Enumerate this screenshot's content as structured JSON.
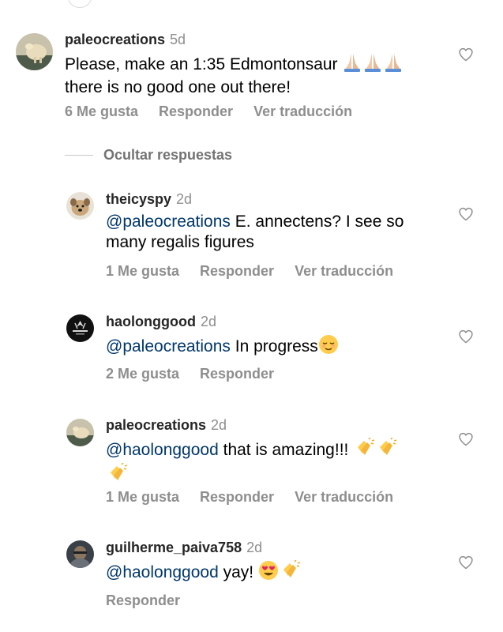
{
  "comments": [
    {
      "username": "paleocreations",
      "time": "5d",
      "mention": "",
      "text": "Please, make an 1:35 Edmontonsaur",
      "text_line2": "there is no good one out there!",
      "likes": "6 Me gusta",
      "reply": "Responder",
      "translate": "Ver traducción"
    },
    {
      "username": "theicyspy",
      "time": "2d",
      "mention": "@paleocreations",
      "text": " E. annectens? I see so",
      "text_line2": "many regalis figures",
      "likes": "1 Me gusta",
      "reply": "Responder",
      "translate": "Ver traducción"
    },
    {
      "username": "haolonggood",
      "time": "2d",
      "mention": "@paleocreations",
      "text": " In progress",
      "likes": "2 Me gusta",
      "reply": "Responder"
    },
    {
      "username": "paleocreations",
      "time": "2d",
      "mention": "@haolonggood",
      "text": " that is amazing!!!",
      "likes": "1 Me gusta",
      "reply": "Responder",
      "translate": "Ver traducción"
    },
    {
      "username": "guilherme_paiva758",
      "time": "2d",
      "mention": "@haolonggood",
      "text": " yay!",
      "reply": "Responder"
    }
  ],
  "replies_toggle": "Ocultar respuestas",
  "icons": {
    "like": "heart-outline-icon",
    "pray": "folded-hands-emoji",
    "relieved": "relieved-face-emoji",
    "clap": "clapping-hands-emoji",
    "hearts": "heart-eyes-emoji"
  },
  "colors": {
    "mention": "#00376b",
    "secondary_text": "#8e8e8e",
    "username": "#262626"
  }
}
